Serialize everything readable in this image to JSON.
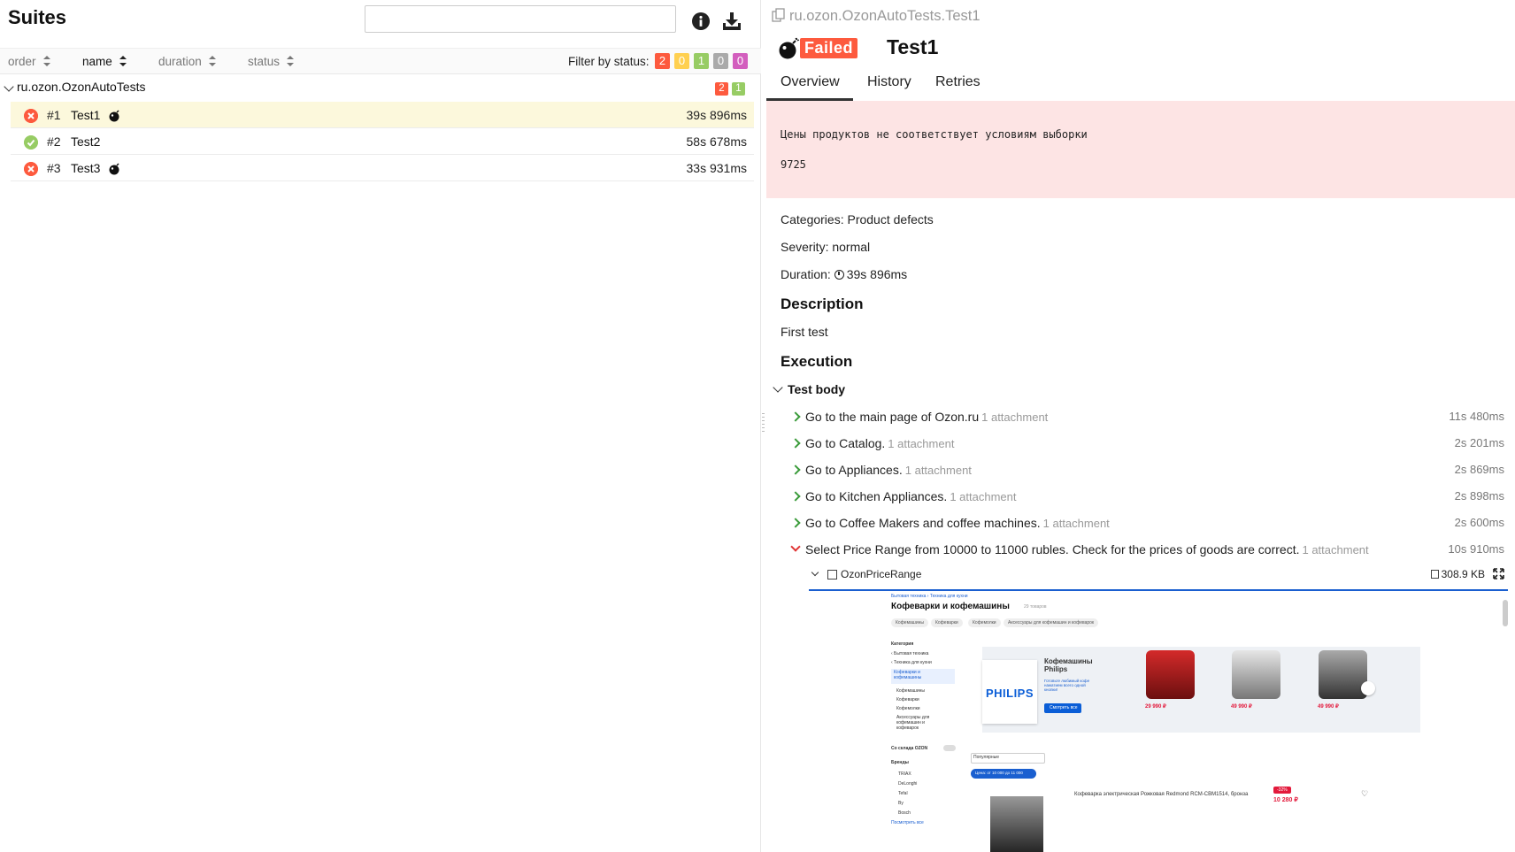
{
  "left": {
    "title": "Suites",
    "search": {
      "value": "",
      "placeholder": ""
    },
    "icons": {
      "info": "info-icon",
      "download": "download-icon"
    },
    "sort_columns": [
      {
        "label": "order",
        "active": false
      },
      {
        "label": "name",
        "active": true
      },
      {
        "label": "duration",
        "active": false
      },
      {
        "label": "status",
        "active": false
      }
    ],
    "filter_label": "Filter by status:",
    "filter_badges": [
      {
        "value": "2",
        "color": "#fd5a3e",
        "status": "failed"
      },
      {
        "value": "0",
        "color": "#ffd050",
        "status": "broken"
      },
      {
        "value": "1",
        "color": "#97cc64",
        "status": "passed"
      },
      {
        "value": "0",
        "color": "#aaaaaa",
        "status": "skipped"
      },
      {
        "value": "0",
        "color": "#d35ebe",
        "status": "unknown"
      }
    ],
    "suite": {
      "name": "ru.ozon.OzonAutoTests",
      "badges": [
        {
          "value": "2",
          "color": "#fd5a3e"
        },
        {
          "value": "1",
          "color": "#97cc64"
        }
      ]
    },
    "tests": [
      {
        "order": "#1",
        "name": "Test1",
        "duration": "39s 896ms",
        "status": "failed",
        "flaky_icon": true,
        "selected": true
      },
      {
        "order": "#2",
        "name": "Test2",
        "duration": "58s 678ms",
        "status": "passed",
        "flaky_icon": false,
        "selected": false
      },
      {
        "order": "#3",
        "name": "Test3",
        "duration": "33s 931ms",
        "status": "failed",
        "flaky_icon": true,
        "selected": false
      }
    ]
  },
  "right": {
    "breadcrumb": "ru.ozon.OzonAutoTests.Test1",
    "status_badge": "Failed",
    "test_title": "Test1",
    "tabs": [
      "Overview",
      "History",
      "Retries"
    ],
    "active_tab": "Overview",
    "error": {
      "message": "Цены продуктов не соответствует условиям выборки",
      "value": "9725"
    },
    "categories_label": "Categories:",
    "categories_value": "Product defects",
    "severity_label": "Severity:",
    "severity_value": "normal",
    "duration_label": "Duration:",
    "duration_value": "39s 896ms",
    "description_heading": "Description",
    "description_text": "First test",
    "execution_heading": "Execution",
    "test_body_label": "Test body",
    "steps": [
      {
        "name": "Go to the main page of Ozon.ru",
        "attachments": "1 attachment",
        "duration": "11s 480ms",
        "status": "passed"
      },
      {
        "name": "Go to Catalog.",
        "attachments": "1 attachment",
        "duration": "2s 201ms",
        "status": "passed"
      },
      {
        "name": "Go to Appliances.",
        "attachments": "1 attachment",
        "duration": "2s 869ms",
        "status": "passed"
      },
      {
        "name": "Go to Kitchen Appliances.",
        "attachments": "1 attachment",
        "duration": "2s 898ms",
        "status": "passed"
      },
      {
        "name": "Go to Coffee Makers and coffee machines.",
        "attachments": "1 attachment",
        "duration": "2s 600ms",
        "status": "passed"
      },
      {
        "name": "Select Price Range from 10000 to 11000 rubles. Check for the prices of goods are correct.",
        "attachments": "1 attachment",
        "duration": "10s 910ms",
        "status": "failed"
      }
    ],
    "attachment": {
      "name": "OzonPriceRange",
      "size": "308.9 KB"
    },
    "screenshot": {
      "breadcrumb": "Бытовая техника  ›  Техника для кухни",
      "heading": "Кофеварки и кофемашины",
      "count": "29 товаров",
      "chips": [
        "Кофемашины",
        "Кофеварки",
        "Кофемолки",
        "Аксессуары для кофемашин и кофеварок"
      ],
      "category_title": "Категория",
      "categories": [
        "‹ Бытовая техника",
        "‹ Техника для кухни",
        "Кофеварки и кофемашины",
        "Кофемашины",
        "Кофеварки",
        "Кофемолки",
        "Аксессуары для кофемашин и кофеварок"
      ],
      "ozon_stock": "Со склада OZON",
      "brands_title": "Бренды",
      "brands": [
        "TRIAX",
        "DeLonghi",
        "Tefal",
        "By",
        "Bosch"
      ],
      "show_all": "Посмотреть все",
      "banner_brand": "PHILIPS",
      "banner_title": "Кофемашины Philips",
      "banner_sub": "Готовьте любимый кофе нажатием всего одной кнопки!",
      "banner_button": "Смотреть все",
      "banner_prices": [
        "29 990 ₽",
        "49 990 ₽",
        "49 990 ₽"
      ],
      "sort_select": "Популярные",
      "price_filter": "Цена: от 10 000 до 11 000",
      "product_title": "Кофеварка электрическая Рожковая Redmond RCM-CBM1514, бронза",
      "product_price": "10 280 ₽",
      "product_discount": "-32%"
    }
  }
}
